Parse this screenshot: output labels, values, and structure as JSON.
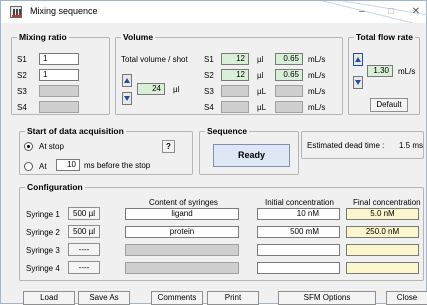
{
  "window": {
    "title": "Mixing sequence",
    "minimize": "–",
    "maximize": "□",
    "close": "✕"
  },
  "mixing_ratio": {
    "legend": "Mixing ratio",
    "rows": [
      {
        "label": "S1",
        "value": "1"
      },
      {
        "label": "S2",
        "value": "1"
      },
      {
        "label": "S3",
        "value": ""
      },
      {
        "label": "S4",
        "value": ""
      }
    ]
  },
  "volume": {
    "legend": "Volume",
    "total_label": "Total volume / shot",
    "total_value": "24",
    "total_unit": "µl",
    "rows": [
      {
        "label": "S1",
        "vol": "12",
        "vol_unit": "µl",
        "rate": "0.65",
        "rate_unit": "mL/s"
      },
      {
        "label": "S2",
        "vol": "12",
        "vol_unit": "µl",
        "rate": "0.65",
        "rate_unit": "mL/s"
      },
      {
        "label": "S3",
        "vol": "",
        "vol_unit": "µL",
        "rate": "",
        "rate_unit": "mL/s"
      },
      {
        "label": "S4",
        "vol": "",
        "vol_unit": "µL",
        "rate": "",
        "rate_unit": "mL/s"
      }
    ]
  },
  "total_flow": {
    "legend": "Total flow rate",
    "value": "1.30",
    "unit": "mL/s",
    "default_button": "Default"
  },
  "acquisition": {
    "legend": "Start of data acquisition",
    "at_stop": "At stop",
    "at": "At",
    "at_value": "10",
    "suffix": "ms before the stop",
    "help_icon": "?"
  },
  "sequence": {
    "legend": "Sequence",
    "button": "Ready"
  },
  "dead_time": {
    "label": "Estimated dead time :",
    "value": "1.5 ms"
  },
  "configuration": {
    "legend": "Configuration",
    "headers": {
      "content": "Content of syringes",
      "initial": "Initial concentration",
      "final": "Final concentration"
    },
    "rows": [
      {
        "label": "Syringe 1",
        "size": "500 µl",
        "content": "ligand",
        "initial": "10 nM",
        "final": "5.0 nM"
      },
      {
        "label": "Syringe 2",
        "size": "500 µl",
        "content": "protein",
        "initial": "500 mM",
        "final": "250.0 nM"
      },
      {
        "label": "Syringe 3",
        "size": "----",
        "content": "",
        "initial": "",
        "final": ""
      },
      {
        "label": "Syringe 4",
        "size": "----",
        "content": "",
        "initial": "",
        "final": ""
      }
    ]
  },
  "buttons": {
    "load": "Load",
    "save_as": "Save As",
    "comments": "Comments",
    "print": "Print",
    "sfm_options": "SFM Options",
    "close": "Close"
  }
}
